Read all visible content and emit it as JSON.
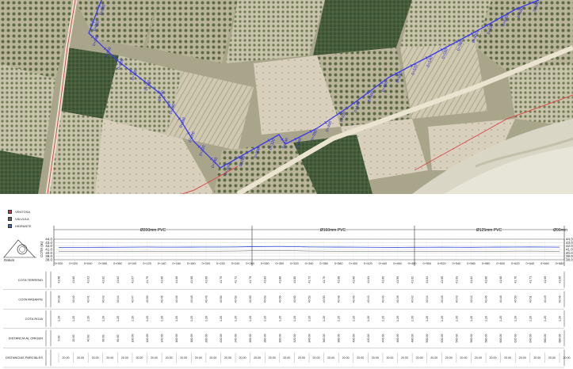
{
  "legend": {
    "items": [
      {
        "label": "VENTOSA",
        "color": "#d33"
      },
      {
        "label": "VÁLVULA",
        "color": "#666"
      },
      {
        "label": "HIDRANTE",
        "color": "#2a6cd8"
      }
    ]
  },
  "map": {
    "route_color": "#3a3af0",
    "road_color": "#e04a4a",
    "labels": [
      "0+000",
      "0+020",
      "0+040",
      "0+060",
      "0+080",
      "0+100",
      "0+120",
      "0+140",
      "0+160",
      "0+180",
      "0+200",
      "0+220",
      "0+240",
      "0+260",
      "0+280",
      "0+300",
      "0+320",
      "0+340",
      "0+360",
      "0+380",
      "0+400",
      "0+420",
      "0+440",
      "0+460",
      "0+480",
      "0+500",
      "0+520",
      "0+540",
      "0+560",
      "0+580",
      "0+600",
      "0+620",
      "0+640",
      "0+660",
      "0+680"
    ]
  },
  "profile": {
    "pipe_labels": [
      "Ø200mm PVC",
      "Ø160mm PVC",
      "Ø125mm PVC",
      "Ø90mm"
    ],
    "y_ticks": [
      "44.0",
      "43.0",
      "42.0",
      "41.0",
      "40.0",
      "39.0",
      "38.0"
    ],
    "y_axis_label": "COTA (m)",
    "datum_label": "Datum",
    "chainages": [
      "0+000",
      "0+020",
      "0+040",
      "0+060",
      "0+080",
      "0+100",
      "0+120",
      "0+140",
      "0+160",
      "0+180",
      "0+200",
      "0+220",
      "0+240",
      "0+260",
      "0+280",
      "0+300",
      "0+320",
      "0+340",
      "0+360",
      "0+380",
      "0+400",
      "0+420",
      "0+440",
      "0+460",
      "0+480",
      "0+500",
      "0+520",
      "0+540",
      "0+560",
      "0+580",
      "0+600",
      "0+620",
      "0+640",
      "0+660",
      "0+680"
    ]
  },
  "table": {
    "rows": [
      {
        "label": "COTA TERRENO",
        "values": [
          "41.58",
          "41.60",
          "41.61",
          "41.62",
          "41.64",
          "41.67",
          "41.70",
          "41.66",
          "41.66",
          "41.68",
          "41.69",
          "41.70",
          "41.72",
          "41.79",
          "41.83",
          "41.86",
          "41.80",
          "41.72",
          "41.70",
          "41.68",
          "41.66",
          "41.63",
          "41.60",
          "41.59",
          "41.62",
          "41.64",
          "41.65",
          "41.63",
          "41.62",
          "41.66",
          "41.68",
          "41.70",
          "41.71",
          "41.69",
          "41.66"
        ]
      },
      {
        "label": "COTA RASANTE",
        "values": [
          "40.38",
          "40.40",
          "40.41",
          "40.42",
          "40.44",
          "40.47",
          "40.50",
          "40.46",
          "40.46",
          "40.48",
          "40.49",
          "40.50",
          "40.52",
          "40.59",
          "40.63",
          "40.66",
          "40.60",
          "40.52",
          "40.50",
          "40.48",
          "40.46",
          "40.43",
          "40.40",
          "40.39",
          "40.42",
          "40.44",
          "40.45",
          "40.43",
          "40.42",
          "40.46",
          "40.48",
          "40.50",
          "40.51",
          "40.49",
          "40.46"
        ]
      },
      {
        "label": "COTA ROJA",
        "values": [
          "1.20",
          "1.20",
          "1.20",
          "1.20",
          "1.20",
          "1.20",
          "1.20",
          "1.20",
          "1.20",
          "1.20",
          "1.20",
          "1.20",
          "1.20",
          "1.20",
          "1.20",
          "1.20",
          "1.20",
          "1.20",
          "1.20",
          "1.20",
          "1.20",
          "1.20",
          "1.20",
          "1.20",
          "1.20",
          "1.20",
          "1.20",
          "1.20",
          "1.20",
          "1.20",
          "1.20",
          "1.20",
          "1.20",
          "1.20",
          "1.20"
        ]
      },
      {
        "label": "DISTANCIA AL ORIGEN",
        "values": [
          "0.00",
          "20.00",
          "40.00",
          "60.00",
          "80.00",
          "100.00",
          "120.00",
          "140.00",
          "160.00",
          "180.00",
          "200.00",
          "220.00",
          "240.00",
          "260.00",
          "280.00",
          "300.00",
          "320.00",
          "340.00",
          "360.00",
          "380.00",
          "400.00",
          "420.00",
          "440.00",
          "460.00",
          "480.00",
          "500.00",
          "520.00",
          "540.00",
          "560.00",
          "580.00",
          "600.00",
          "620.00",
          "640.00",
          "660.00",
          "680.00"
        ]
      },
      {
        "label": "DISTANCIAS PARCIALES",
        "values": [
          "20.00",
          "20.00",
          "20.00",
          "20.00",
          "20.00",
          "20.00",
          "20.00",
          "20.00",
          "20.00",
          "20.00",
          "20.00",
          "20.00",
          "20.00",
          "20.00",
          "20.00",
          "20.00",
          "20.00",
          "20.00",
          "20.00",
          "20.00",
          "20.00",
          "20.00",
          "20.00",
          "20.00",
          "20.00",
          "20.00",
          "20.00",
          "20.00",
          "20.00",
          "20.00",
          "20.00",
          "20.00",
          "20.00",
          "20.00",
          "20.00"
        ]
      }
    ]
  }
}
